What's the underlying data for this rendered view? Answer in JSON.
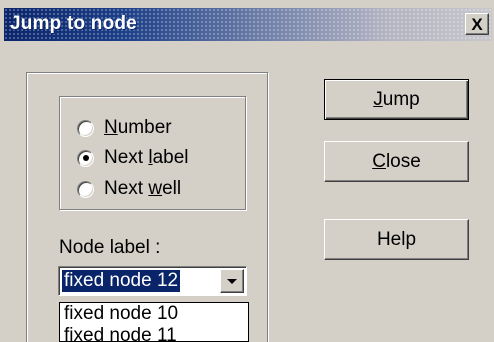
{
  "window": {
    "title": "Jump to node",
    "close_glyph": "X"
  },
  "jump_mode": {
    "options": [
      {
        "label_prefix": "",
        "label_mnemonic": "N",
        "label_suffix": "umber",
        "selected": false
      },
      {
        "label_prefix": "Next ",
        "label_mnemonic": "l",
        "label_suffix": "abel",
        "selected": true
      },
      {
        "label_prefix": "Next ",
        "label_mnemonic": "w",
        "label_suffix": "ell",
        "selected": false
      }
    ]
  },
  "node_label": {
    "caption": "Node label :",
    "selected_value": "fixed node 12",
    "dropdown_items": [
      "fixed node 10",
      "fixed node 11"
    ]
  },
  "buttons": {
    "jump": {
      "mnemonic": "J",
      "rest": "ump"
    },
    "close": {
      "mnemonic": "C",
      "rest": "lose"
    },
    "help": "Help"
  },
  "colors": {
    "dialog_face": "#d4d0c8",
    "title_active": "#0a246a",
    "selection": "#0a246a"
  }
}
